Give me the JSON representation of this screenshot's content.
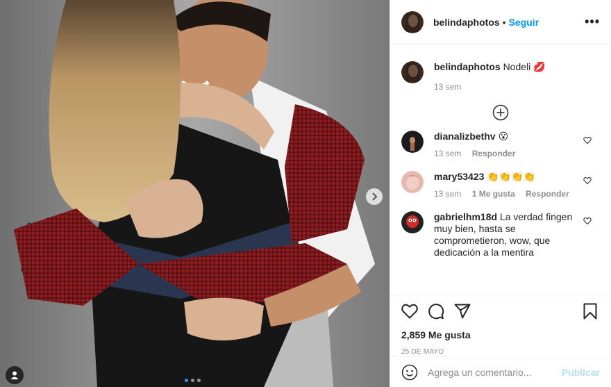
{
  "post": {
    "username": "belindaphotos",
    "separator": "•",
    "follow_label": "Seguir",
    "more_label": "•••",
    "caption_text": "Nodeli 💋",
    "caption_time": "13 sem"
  },
  "comments": [
    {
      "username": "dianalizbethv",
      "text": "😮",
      "time": "13 sem",
      "likes": "",
      "reply_label": "Responder"
    },
    {
      "username": "mary53423",
      "text": "👏👏👏👏",
      "time": "13 sem",
      "likes": "1 Me gusta",
      "reply_label": "Responder"
    },
    {
      "username": "gabrielhm18d",
      "text": "La verdad fingen muy bien, hasta se comprometieron, wow, que dedicación a la mentira",
      "time": "",
      "likes": "",
      "reply_label": ""
    }
  ],
  "engagement": {
    "likes_count": "2,859 Me gusta",
    "date": "25 DE MAYO"
  },
  "composer": {
    "placeholder": "Agrega un comentario...",
    "publish_label": "Publicar"
  },
  "carousel": {
    "current": 1,
    "total": 3
  },
  "colors": {
    "accent": "#0095f6",
    "publish_disabled": "#b2dffc",
    "carousel_active": "#3897f0"
  },
  "icons": [
    "emoji-icon",
    "heart-icon",
    "comment-icon",
    "share-icon",
    "bookmark-icon",
    "add-circle-icon",
    "chevron-right-icon",
    "user-tag-icon"
  ]
}
